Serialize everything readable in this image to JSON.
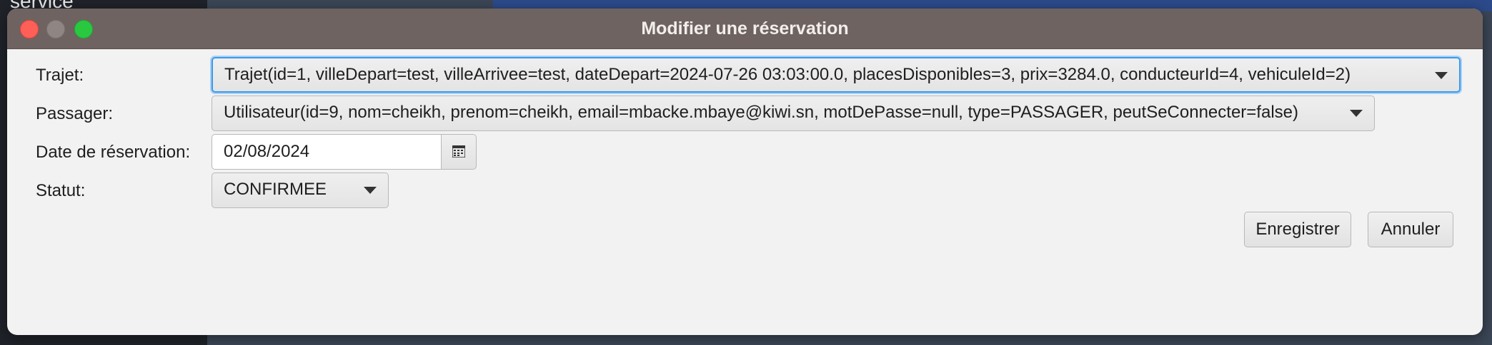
{
  "background": {
    "left_text_top": "service"
  },
  "window": {
    "title": "Modifier une réservation"
  },
  "form": {
    "trajet": {
      "label": "Trajet:",
      "value": "Trajet(id=1, villeDepart=test, villeArrivee=test, dateDepart=2024-07-26 03:03:00.0, placesDisponibles=3, prix=3284.0, conducteurId=4, vehiculeId=2)"
    },
    "passager": {
      "label": "Passager:",
      "value": "Utilisateur(id=9, nom=cheikh, prenom=cheikh, email=mbacke.mbaye@kiwi.sn, motDePasse=null, type=PASSAGER, peutSeConnecter=false)"
    },
    "date": {
      "label": "Date de réservation:",
      "value": "02/08/2024",
      "icon": "calendar-icon"
    },
    "statut": {
      "label": "Statut:",
      "value": "CONFIRMEE"
    }
  },
  "buttons": {
    "save": "Enregistrer",
    "cancel": "Annuler"
  },
  "colors": {
    "titlebar": "#6e6360",
    "focus": "#3d9ae8",
    "close": "#fe5f57",
    "maximize": "#2ac840"
  }
}
